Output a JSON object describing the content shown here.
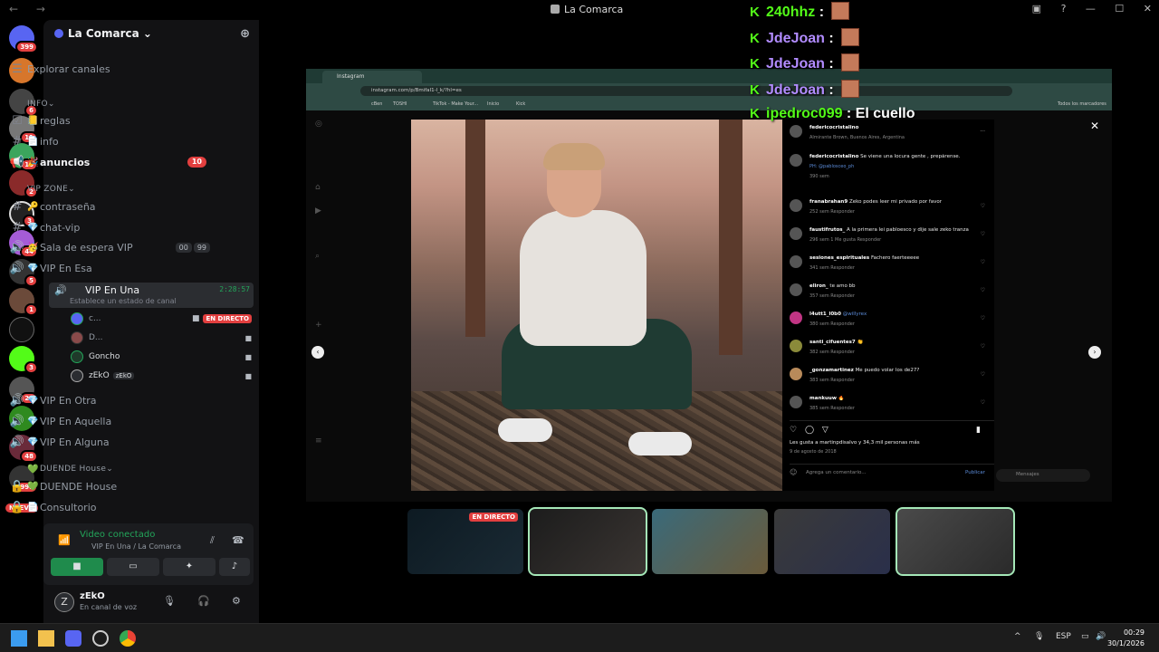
{
  "titlebar": {
    "title": "La Comarca",
    "nav": "← →"
  },
  "rail": {
    "badges": [
      "399",
      "6",
      "11",
      "10",
      "2",
      "3",
      "44",
      "5",
      "1",
      "3",
      "23",
      "48",
      "998"
    ],
    "new_label": "NUEVO"
  },
  "server": {
    "name": "La Comarca"
  },
  "sidebar": {
    "explore": "Explorar canales",
    "cat_info": "INFO",
    "ch_reglas": "reglas",
    "ch_info": "info",
    "ch_anuncios": "anuncios",
    "anuncios_badge": "10",
    "cat_vip": "VIP ZONE",
    "ch_contrasena": "contraseña",
    "ch_chatvip": "chat-vip",
    "ch_sala": "Sala de espera VIP",
    "sala_count_a": "00",
    "sala_count_b": "99",
    "ch_vip_esa": "VIP En Esa",
    "ch_vip_una": "VIP En Una",
    "vip_una_timer": "2:28:57",
    "vip_una_status": "Establece un estado de canal",
    "members": [
      {
        "name": "c...",
        "live": "EN DIRECTO"
      },
      {
        "name": "D..."
      },
      {
        "name": "Goncho"
      },
      {
        "name": "zEkO",
        "tag": "zEkO"
      }
    ],
    "ch_vip_otra": "VIP En Otra",
    "ch_vip_aquella": "VIP En Aquella",
    "ch_vip_alguna": "VIP En Alguna",
    "cat_duende": "DUENDE House",
    "ch_duende": "DUENDE House",
    "ch_consultorio": "Consultorio"
  },
  "voice_panel": {
    "title": "Video conectado",
    "subtitle": "VIP En Una / La Comarca"
  },
  "user": {
    "name": "zEkO",
    "status": "En canal de voz"
  },
  "browser": {
    "tab": "Instagram",
    "url": "instagram.com/p/BmifaI1-l_k/?hl=es",
    "bookmarks": [
      "cBen",
      "TOSHI",
      "TikTok - Make Your...",
      "Inicio",
      "Kick"
    ],
    "bookmarks_right": "Todos los marcadores"
  },
  "post": {
    "author": "federicocristalino",
    "location": "Almirante Brown, Buenos Aires, Argentina",
    "caption": "Se viene una locura gente , prepárense.",
    "photo_credit": "PH: @pablosceo_ph",
    "caption_time": "390 sem",
    "likes": "Les gusta a martinpdisalvo y 34,3 mil personas más",
    "date": "9 de agosto de 2018",
    "comment_placeholder": "Agrega un comentario...",
    "publish": "Publicar",
    "messages": "Mensajes",
    "comments": [
      {
        "user": "franabrahan9",
        "text": "Zeko podes leer mi privado por favor",
        "meta": "252 sem   Responder"
      },
      {
        "user": "faustifrutos_",
        "text": "A la primera lei pabloesco y dije sale zeko tranza",
        "meta": "296 sem   1 Me gusta   Responder"
      },
      {
        "user": "sesiones_espirituales",
        "text": "Fachero faerteeeee",
        "meta": "341 sem   Responder"
      },
      {
        "user": "eliron_",
        "text": "te amo bb",
        "meta": "357 sem   Responder"
      },
      {
        "user": "l4utt1_l0b0",
        "text": "@willyrex",
        "meta": "380 sem   Responder"
      },
      {
        "user": "santi_cifuentes7",
        "text": "👏",
        "meta": "382 sem   Responder"
      },
      {
        "user": "_gonzamartinez",
        "text": "Me puedo volar los de27?",
        "meta": "383 sem   Responder"
      },
      {
        "user": "mankuuw",
        "text": "🔥",
        "meta": "385 sem   Responder"
      }
    ]
  },
  "chat": [
    {
      "user": "240hhz",
      "message": ""
    },
    {
      "user": "JdeJoan",
      "message": ""
    },
    {
      "user": "JdeJoan",
      "message": ""
    },
    {
      "user": "JdeJoan",
      "message": ""
    },
    {
      "user": "ipedroc099",
      "message": "El cuello"
    }
  ],
  "thumbs": {
    "live": "EN DIRECTO"
  },
  "taskbar": {
    "lang": "ESP",
    "time": "00:29",
    "date": "30/1/2026"
  }
}
